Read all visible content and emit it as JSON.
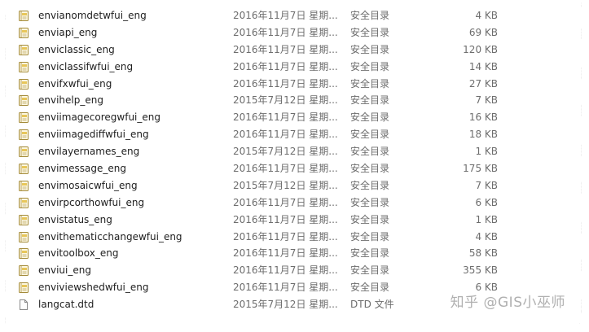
{
  "files": [
    {
      "name": "envianomdetwfui_eng",
      "date": "2016年11月7日 星期...",
      "type": "安全目录",
      "size": "4 KB",
      "icon": "security-catalog-icon"
    },
    {
      "name": "enviapi_eng",
      "date": "2016年11月7日 星期...",
      "type": "安全目录",
      "size": "69 KB",
      "icon": "security-catalog-icon"
    },
    {
      "name": "enviclassic_eng",
      "date": "2016年11月7日 星期...",
      "type": "安全目录",
      "size": "120 KB",
      "icon": "security-catalog-icon"
    },
    {
      "name": "enviclassifwfui_eng",
      "date": "2016年11月7日 星期...",
      "type": "安全目录",
      "size": "14 KB",
      "icon": "security-catalog-icon"
    },
    {
      "name": "envifxwfui_eng",
      "date": "2016年11月7日 星期...",
      "type": "安全目录",
      "size": "27 KB",
      "icon": "security-catalog-icon"
    },
    {
      "name": "envihelp_eng",
      "date": "2015年7月12日 星期...",
      "type": "安全目录",
      "size": "7 KB",
      "icon": "security-catalog-icon"
    },
    {
      "name": "enviimagecoregwfui_eng",
      "date": "2016年11月7日 星期...",
      "type": "安全目录",
      "size": "16 KB",
      "icon": "security-catalog-icon"
    },
    {
      "name": "enviimagediffwfui_eng",
      "date": "2016年11月7日 星期...",
      "type": "安全目录",
      "size": "18 KB",
      "icon": "security-catalog-icon"
    },
    {
      "name": "envilayernames_eng",
      "date": "2015年7月12日 星期...",
      "type": "安全目录",
      "size": "1 KB",
      "icon": "security-catalog-icon"
    },
    {
      "name": "envimessage_eng",
      "date": "2016年11月7日 星期...",
      "type": "安全目录",
      "size": "175 KB",
      "icon": "security-catalog-icon"
    },
    {
      "name": "envimosaicwfui_eng",
      "date": "2015年7月12日 星期...",
      "type": "安全目录",
      "size": "7 KB",
      "icon": "security-catalog-icon"
    },
    {
      "name": "envirpcorthowfui_eng",
      "date": "2016年11月7日 星期...",
      "type": "安全目录",
      "size": "6 KB",
      "icon": "security-catalog-icon"
    },
    {
      "name": "envistatus_eng",
      "date": "2016年11月7日 星期...",
      "type": "安全目录",
      "size": "1 KB",
      "icon": "security-catalog-icon"
    },
    {
      "name": "envithematicchangewfui_eng",
      "date": "2016年11月7日 星期...",
      "type": "安全目录",
      "size": "4 KB",
      "icon": "security-catalog-icon"
    },
    {
      "name": "envitoolbox_eng",
      "date": "2016年11月7日 星期...",
      "type": "安全目录",
      "size": "58 KB",
      "icon": "security-catalog-icon"
    },
    {
      "name": "enviui_eng",
      "date": "2016年11月7日 星期...",
      "type": "安全目录",
      "size": "355 KB",
      "icon": "security-catalog-icon"
    },
    {
      "name": "enviviewshedwfui_eng",
      "date": "2016年11月7日 星期...",
      "type": "安全目录",
      "size": "6 KB",
      "icon": "security-catalog-icon"
    },
    {
      "name": "langcat.dtd",
      "date": "2015年7月12日 星期...",
      "type": "DTD 文件",
      "size": "",
      "icon": "dtd-file-icon"
    }
  ],
  "watermark": "知乎 @GIS小巫师",
  "colors": {
    "text": "#1e1e1e",
    "meta": "#6d6d6d",
    "icon_accent": "#e7c65a"
  }
}
